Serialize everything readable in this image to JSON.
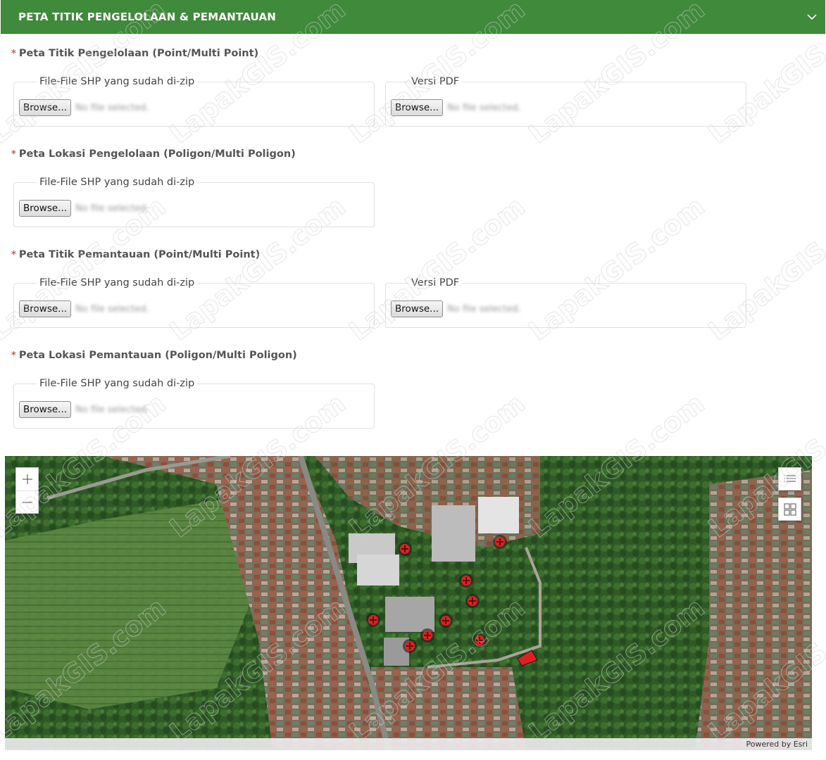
{
  "panel": {
    "title": "PETA TITIK PENGELOLAAN & PEMANTAUAN",
    "collapse_icon": "chevron-down-icon"
  },
  "sections": [
    {
      "required_mark": "*",
      "label": "Peta Titik Pengelolaan (Point/Multi Point)",
      "fields": [
        {
          "legend": "File-File SHP yang sudah di-zip",
          "button": "Browse...",
          "status": "No file selected."
        },
        {
          "legend": "Versi PDF",
          "button": "Browse...",
          "status": "No file selected."
        }
      ]
    },
    {
      "required_mark": "*",
      "label": "Peta Lokasi Pengelolaan (Poligon/Multi Poligon)",
      "fields": [
        {
          "legend": "File-File SHP yang sudah di-zip",
          "button": "Browse...",
          "status": "No file selected."
        }
      ]
    },
    {
      "required_mark": "*",
      "label": "Peta Titik Pemantauan (Point/Multi Point)",
      "fields": [
        {
          "legend": "File-File SHP yang sudah di-zip",
          "button": "Browse...",
          "status": "No file selected."
        },
        {
          "legend": "Versi PDF",
          "button": "Browse...",
          "status": "No file selected."
        }
      ]
    },
    {
      "required_mark": "*",
      "label": "Peta Lokasi Pemantauan (Poligon/Multi Poligon)",
      "fields": [
        {
          "legend": "File-File SHP yang sudah di-zip",
          "button": "Browse...",
          "status": "No file selected."
        }
      ]
    }
  ],
  "map": {
    "attribution": "Powered by Esri",
    "controls": {
      "zoom_in_icon": "plus-icon",
      "zoom_out_icon": "minus-icon",
      "layer_list_icon": "list-icon",
      "basemap_gallery_icon": "grid-icon"
    },
    "marker_color": "#e02020"
  },
  "watermark": "LapakGIS.com"
}
